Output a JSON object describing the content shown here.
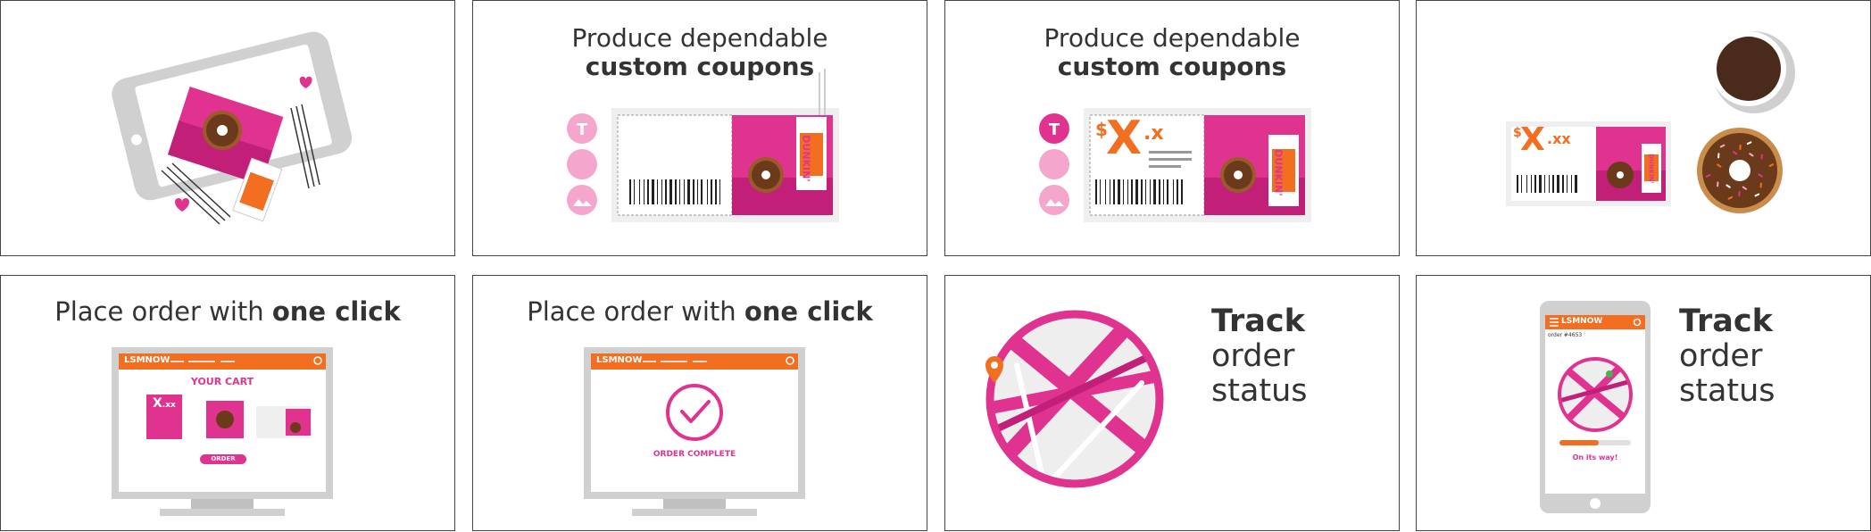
{
  "colors": {
    "pink": "#e0338f",
    "light_pink": "#f4a6cc",
    "orange": "#f26f21",
    "gray": "#c8c8c8",
    "dark_text": "#333333"
  },
  "panels": {
    "p1": {
      "icons": [
        "phone-icon",
        "coupon-icon",
        "donut-icon",
        "coffee-cup-icon",
        "heart-icon"
      ]
    },
    "p2": {
      "heading_line1": "Produce dependable",
      "heading_line2": "custom coupons",
      "tool_icons": [
        "text-tool-icon",
        "palette-icon",
        "image-icon"
      ],
      "cup_brand": "DUNKIN'"
    },
    "p3": {
      "heading_line1": "Produce dependable",
      "heading_line2": "custom coupons",
      "price_symbol": "$",
      "price_main": "X",
      "price_cents": ".x",
      "cup_brand": "DUNKIN'"
    },
    "p4": {
      "price_symbol": "$",
      "price_main": "X",
      "price_cents": ".xx",
      "cup_brand": "DUNKIN'"
    },
    "p5": {
      "heading_prefix": "Place order with ",
      "heading_bold": "one click",
      "brand": "LSMNOW",
      "cart_title": "YOUR CART",
      "order_button": "ORDER",
      "coupon_price": "X",
      "coupon_cents": ".xx"
    },
    "p6": {
      "heading_prefix": "Place order with ",
      "heading_bold": "one click",
      "brand": "LSMNOW",
      "complete_text": "ORDER COMPLETE"
    },
    "p7": {
      "track_bold": "Track",
      "track_line2": "order",
      "track_line3": "status"
    },
    "p8": {
      "track_bold": "Track",
      "track_line2": "order",
      "track_line3": "status",
      "brand": "LSMNOW",
      "order_number": "order #4653",
      "status_text": "On its way!",
      "progress": 0.55
    }
  }
}
